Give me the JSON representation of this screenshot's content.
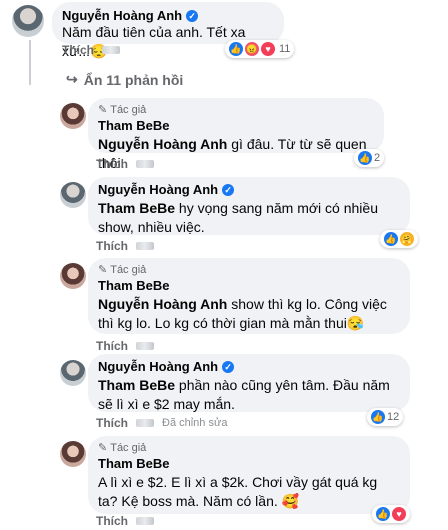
{
  "comments": [
    {
      "author": "Nguyễn Hoàng Anh",
      "verified": true,
      "text": "Năm đầu tiên của anh. Tết xa xứ...",
      "emoji": "😔",
      "like_label": "Thích",
      "reaction_count": "11"
    }
  ],
  "hide_replies_label": "Ẩn 11 phản hồi",
  "replies": [
    {
      "author_tag": "Tác giả",
      "author": "Tham BeBe",
      "mention": "Nguyễn Hoàng Anh",
      "text": " gì đâu. Từ từ sẽ quen thôi.",
      "like_label": "Thích",
      "reaction_count": "2"
    },
    {
      "author": "Nguyễn Hoàng Anh",
      "verified": true,
      "mention": "Tham BeBe",
      "text": " hy vọng sang năm mới có nhiều show, nhiều việc.",
      "like_label": "Thích"
    },
    {
      "author_tag": "Tác giả",
      "author": "Tham BeBe",
      "mention": "Nguyễn Hoàng Anh",
      "text": " show thì kg lo. Công việc thì kg lo. Lo kg có thời gian mà mằn thui",
      "emoji": "😪",
      "like_label": "Thích"
    },
    {
      "author": "Nguyễn Hoàng Anh",
      "verified": true,
      "mention": "Tham BeBe",
      "text": " phần nào cũng yên tâm. Đầu năm sẽ lì xì e $2 may mắn.",
      "like_label": "Thích",
      "edited_label": "Đã chỉnh sửa",
      "reaction_count": "12"
    },
    {
      "author_tag": "Tác giả",
      "author": "Tham BeBe",
      "text": "A lì xì e $2. E lì xì a $2k. Chơi vầy gát quá kg ta? Kệ boss mà. Năm có lần. ",
      "emoji": "🥰",
      "like_label": "Thích"
    }
  ],
  "colors": {
    "bubble": "#f0f2f5",
    "meta": "#65676b",
    "verified": "#1877f2"
  }
}
